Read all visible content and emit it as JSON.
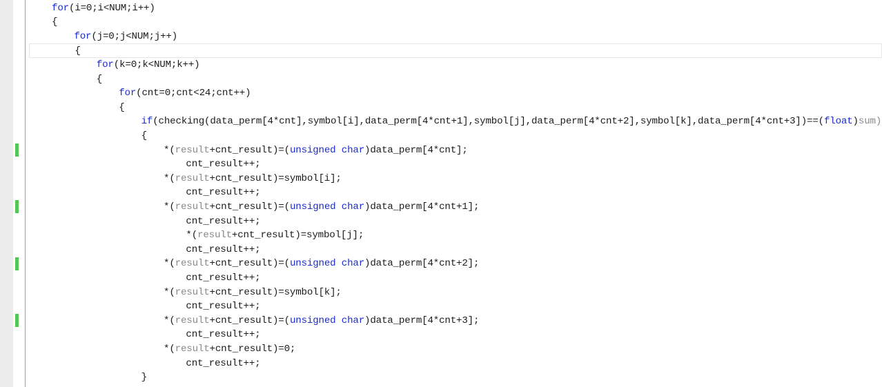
{
  "editor": {
    "colors": {
      "keyword": "#1b2cd0",
      "text": "#1c1c1c",
      "dim": "#8a8a8a",
      "gutter": "#ececec",
      "change_marker": "#54c654",
      "current_line_border": "#e6e6e6"
    },
    "current_line_index": 3,
    "change_marker_lines": [
      10,
      14,
      18,
      22
    ],
    "lines": [
      {
        "indent": 1,
        "tokens": [
          {
            "t": "for",
            "k": "kw"
          },
          {
            "t": "(i=0;i<NUM;i++)",
            "k": "plain"
          }
        ]
      },
      {
        "indent": 1,
        "tokens": [
          {
            "t": "{",
            "k": "plain"
          }
        ]
      },
      {
        "indent": 2,
        "tokens": [
          {
            "t": "for",
            "k": "kw"
          },
          {
            "t": "(j=0;j<NUM;j++)",
            "k": "plain"
          }
        ]
      },
      {
        "indent": 2,
        "tokens": [
          {
            "t": "{",
            "k": "plain"
          }
        ]
      },
      {
        "indent": 3,
        "tokens": [
          {
            "t": "for",
            "k": "kw"
          },
          {
            "t": "(k=0;k<NUM;k++)",
            "k": "plain"
          }
        ]
      },
      {
        "indent": 3,
        "tokens": [
          {
            "t": "{",
            "k": "plain"
          }
        ]
      },
      {
        "indent": 4,
        "tokens": [
          {
            "t": "for",
            "k": "kw"
          },
          {
            "t": "(cnt=0;cnt<24;cnt++)",
            "k": "plain"
          }
        ]
      },
      {
        "indent": 4,
        "tokens": [
          {
            "t": "{",
            "k": "plain"
          }
        ]
      },
      {
        "indent": 5,
        "tokens": [
          {
            "t": "if",
            "k": "kw"
          },
          {
            "t": "(checking(data_perm[4*cnt],symbol[i],data_perm[4*cnt+1],symbol[j],data_perm[4*cnt+2],symbol[k],data_perm[4*cnt+3])==(",
            "k": "plain"
          },
          {
            "t": "float",
            "k": "kw"
          },
          {
            "t": ")",
            "k": "plain"
          },
          {
            "t": "sum)",
            "k": "var"
          }
        ]
      },
      {
        "indent": 5,
        "tokens": [
          {
            "t": "{",
            "k": "plain"
          }
        ]
      },
      {
        "indent": 6,
        "tokens": [
          {
            "t": "*(",
            "k": "plain"
          },
          {
            "t": "result",
            "k": "var"
          },
          {
            "t": "+cnt_result)=(",
            "k": "plain"
          },
          {
            "t": "unsigned char",
            "k": "kw"
          },
          {
            "t": ")data_perm[4*cnt];",
            "k": "plain"
          }
        ]
      },
      {
        "indent": 7,
        "tokens": [
          {
            "t": "cnt_result++;",
            "k": "plain"
          }
        ]
      },
      {
        "indent": 6,
        "tokens": [
          {
            "t": "*(",
            "k": "plain"
          },
          {
            "t": "result",
            "k": "var"
          },
          {
            "t": "+cnt_result)=symbol[i];",
            "k": "plain"
          }
        ]
      },
      {
        "indent": 7,
        "tokens": [
          {
            "t": "cnt_result++;",
            "k": "plain"
          }
        ]
      },
      {
        "indent": 6,
        "tokens": [
          {
            "t": "*(",
            "k": "plain"
          },
          {
            "t": "result",
            "k": "var"
          },
          {
            "t": "+cnt_result)=(",
            "k": "plain"
          },
          {
            "t": "unsigned char",
            "k": "kw"
          },
          {
            "t": ")data_perm[4*cnt+1];",
            "k": "plain"
          }
        ]
      },
      {
        "indent": 7,
        "tokens": [
          {
            "t": "cnt_result++;",
            "k": "plain"
          }
        ]
      },
      {
        "indent": 7,
        "tokens": [
          {
            "t": "*(",
            "k": "plain"
          },
          {
            "t": "result",
            "k": "var"
          },
          {
            "t": "+cnt_result)=symbol[j];",
            "k": "plain"
          }
        ]
      },
      {
        "indent": 7,
        "tokens": [
          {
            "t": "cnt_result++;",
            "k": "plain"
          }
        ]
      },
      {
        "indent": 6,
        "tokens": [
          {
            "t": "*(",
            "k": "plain"
          },
          {
            "t": "result",
            "k": "var"
          },
          {
            "t": "+cnt_result)=(",
            "k": "plain"
          },
          {
            "t": "unsigned char",
            "k": "kw"
          },
          {
            "t": ")data_perm[4*cnt+2];",
            "k": "plain"
          }
        ]
      },
      {
        "indent": 7,
        "tokens": [
          {
            "t": "cnt_result++;",
            "k": "plain"
          }
        ]
      },
      {
        "indent": 6,
        "tokens": [
          {
            "t": "*(",
            "k": "plain"
          },
          {
            "t": "result",
            "k": "var"
          },
          {
            "t": "+cnt_result)=symbol[k];",
            "k": "plain"
          }
        ]
      },
      {
        "indent": 7,
        "tokens": [
          {
            "t": "cnt_result++;",
            "k": "plain"
          }
        ]
      },
      {
        "indent": 6,
        "tokens": [
          {
            "t": "*(",
            "k": "plain"
          },
          {
            "t": "result",
            "k": "var"
          },
          {
            "t": "+cnt_result)=(",
            "k": "plain"
          },
          {
            "t": "unsigned char",
            "k": "kw"
          },
          {
            "t": ")data_perm[4*cnt+3];",
            "k": "plain"
          }
        ]
      },
      {
        "indent": 7,
        "tokens": [
          {
            "t": "cnt_result++;",
            "k": "plain"
          }
        ]
      },
      {
        "indent": 6,
        "tokens": [
          {
            "t": "*(",
            "k": "plain"
          },
          {
            "t": "result",
            "k": "var"
          },
          {
            "t": "+cnt_result)=0;",
            "k": "plain"
          }
        ]
      },
      {
        "indent": 7,
        "tokens": [
          {
            "t": "cnt_result++;",
            "k": "plain"
          }
        ]
      },
      {
        "indent": 5,
        "tokens": [
          {
            "t": "}",
            "k": "plain"
          }
        ]
      }
    ]
  }
}
